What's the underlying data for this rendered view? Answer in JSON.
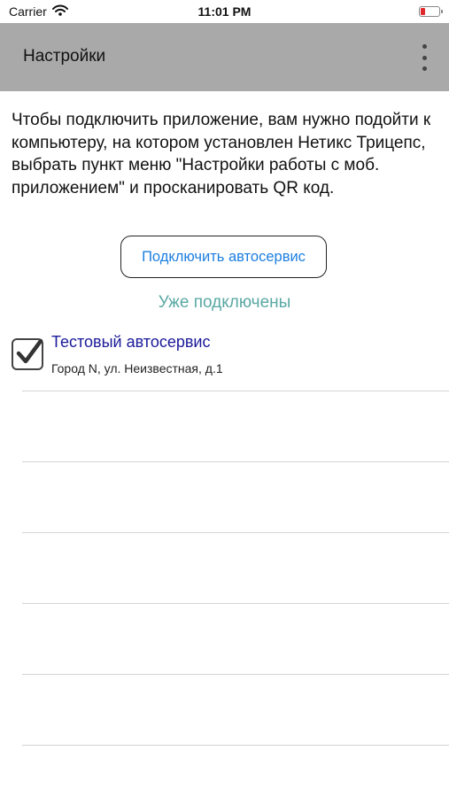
{
  "status_bar": {
    "carrier": "Carrier",
    "time": "11:01 PM"
  },
  "header": {
    "title": "Настройки"
  },
  "instructions": "Чтобы подключить приложение, вам нужно подойти к компьютеру, на котором установлен Нетикс Трицепс, выбрать пункт меню \"Настройки работы с моб. приложением\" и просканировать QR код.",
  "connect_button": {
    "label": "Подключить автосервис"
  },
  "connected_label": "Уже подключены",
  "services": [
    {
      "name": "Тестовый автосервис",
      "address": "Город N, ул. Неизвестная, д.1",
      "checked": true
    }
  ]
}
